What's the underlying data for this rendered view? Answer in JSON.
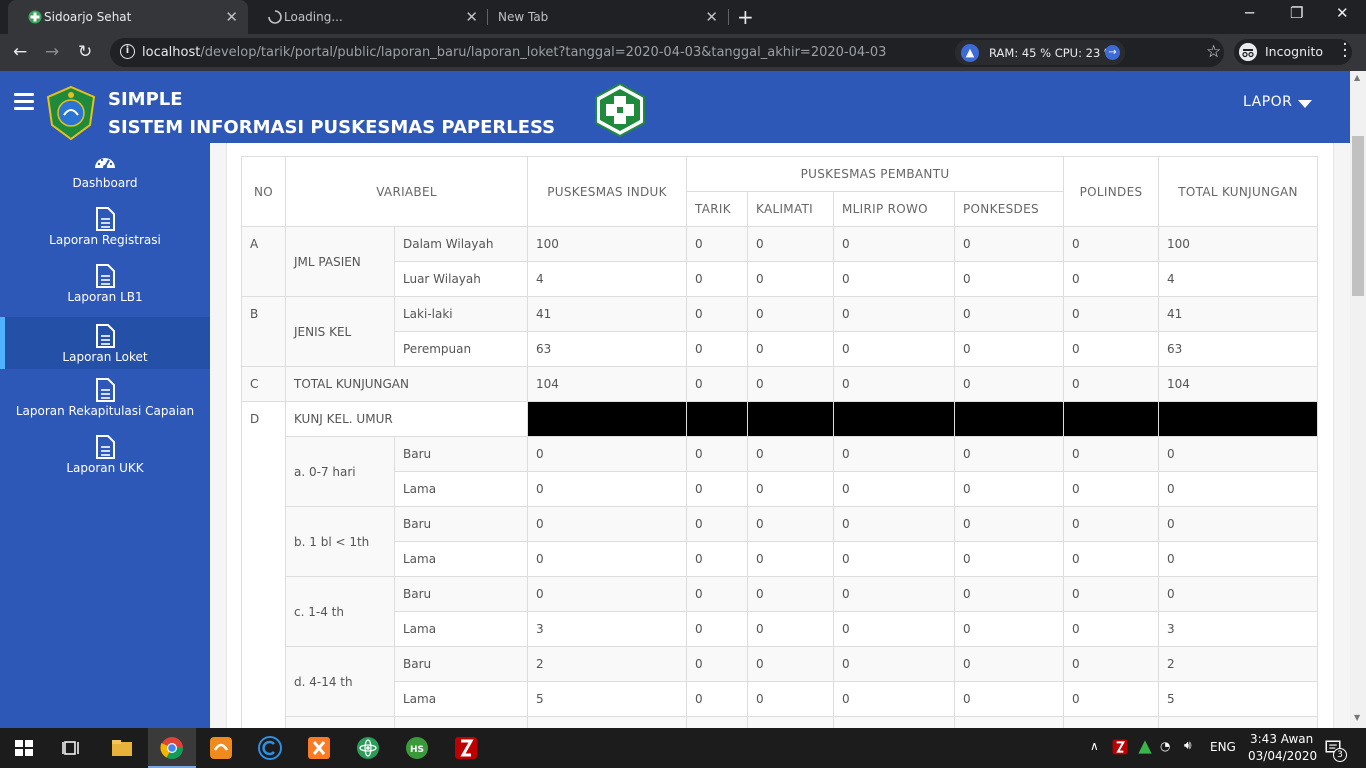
{
  "browser": {
    "tabs": [
      {
        "title": "Sidoarjo Sehat"
      },
      {
        "title": "Loading..."
      },
      {
        "title": "New Tab"
      }
    ],
    "url_host": "localhost",
    "url_path": "/develop/tarik/portal/public/laporan_baru/laporan_loket?tanggal=2020-04-03&tanggal_akhir=2020-04-03",
    "ram_cpu": "RAM: 45 %  CPU: 23 %",
    "incognito_label": "Incognito"
  },
  "app": {
    "title_line1": "SIMPLE",
    "title_line2": "SISTEM INFORMASI PUSKESMAS PAPERLESS",
    "menu_label": "LAPOR"
  },
  "sidebar": {
    "items": [
      {
        "label": "Dashboard",
        "icon": "dashboard-icon"
      },
      {
        "label": "Laporan Registrasi",
        "icon": "document-icon"
      },
      {
        "label": "Laporan LB1",
        "icon": "document-icon"
      },
      {
        "label": "Laporan Loket",
        "icon": "document-icon",
        "active": true
      },
      {
        "label": "Laporan Rekapitulasi Capaian",
        "icon": "document-icon"
      },
      {
        "label": "Laporan UKK",
        "icon": "document-icon"
      }
    ]
  },
  "table": {
    "headers": {
      "no": "NO",
      "variabel": "VARIABEL",
      "induk": "PUSKESMAS INDUK",
      "pembantu": "PUSKESMAS PEMBANTU",
      "polindes": "POLINDES",
      "total": "TOTAL KUNJUNGAN",
      "sub": [
        "TARIK",
        "KALIMATI",
        "MLIRIP ROWO",
        "PONKESDES"
      ]
    },
    "groups": {
      "A": {
        "no": "A",
        "label": "JML PASIEN"
      },
      "B": {
        "no": "B",
        "label": "JENIS KEL"
      },
      "C": {
        "no": "C",
        "label": "TOTAL KUNJUNGAN"
      },
      "D": {
        "no": "D",
        "label": "KUNJ KEL. UMUR"
      }
    },
    "subgroups": [
      "a. 0-7 hari",
      "b. 1 bl < 1th",
      "c. 1-4 th",
      "d. 4-14 th"
    ],
    "rows": [
      {
        "label": "Dalam Wilayah",
        "v": [
          "100",
          "0",
          "0",
          "0",
          "0",
          "0",
          "100"
        ]
      },
      {
        "label": "Luar Wilayah",
        "v": [
          "4",
          "0",
          "0",
          "0",
          "0",
          "0",
          "4"
        ]
      },
      {
        "label": "Laki-laki",
        "v": [
          "41",
          "0",
          "0",
          "0",
          "0",
          "0",
          "41"
        ]
      },
      {
        "label": "Perempuan",
        "v": [
          "63",
          "0",
          "0",
          "0",
          "0",
          "0",
          "63"
        ]
      },
      {
        "label": "",
        "v": [
          "104",
          "0",
          "0",
          "0",
          "0",
          "0",
          "104"
        ]
      },
      {
        "label": "Baru",
        "v": [
          "0",
          "0",
          "0",
          "0",
          "0",
          "0",
          "0"
        ]
      },
      {
        "label": "Lama",
        "v": [
          "0",
          "0",
          "0",
          "0",
          "0",
          "0",
          "0"
        ]
      },
      {
        "label": "Baru",
        "v": [
          "0",
          "0",
          "0",
          "0",
          "0",
          "0",
          "0"
        ]
      },
      {
        "label": "Lama",
        "v": [
          "0",
          "0",
          "0",
          "0",
          "0",
          "0",
          "0"
        ]
      },
      {
        "label": "Baru",
        "v": [
          "0",
          "0",
          "0",
          "0",
          "0",
          "0",
          "0"
        ]
      },
      {
        "label": "Lama",
        "v": [
          "3",
          "0",
          "0",
          "0",
          "0",
          "0",
          "3"
        ]
      },
      {
        "label": "Baru",
        "v": [
          "2",
          "0",
          "0",
          "0",
          "0",
          "0",
          "2"
        ]
      },
      {
        "label": "Lama",
        "v": [
          "5",
          "0",
          "0",
          "0",
          "0",
          "0",
          "5"
        ]
      }
    ]
  },
  "taskbar": {
    "language": "ENG",
    "time": "3:43 Awan",
    "date": "03/04/2020",
    "notification_count": "3"
  },
  "colors": {
    "brand_blue": "#2e58b8",
    "sidebar_active_accent": "#4fb3ff"
  }
}
